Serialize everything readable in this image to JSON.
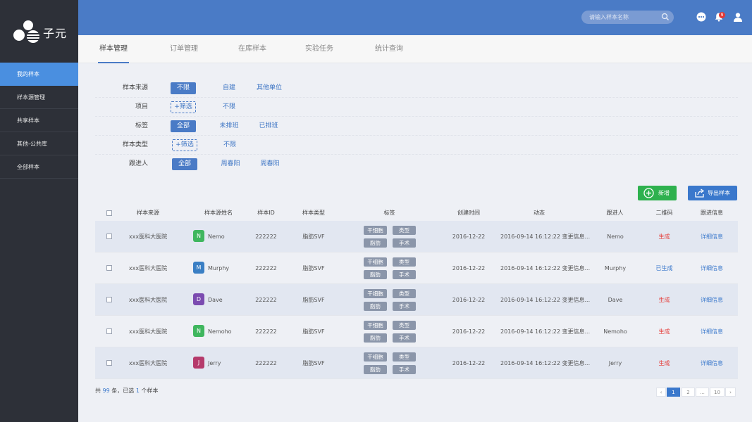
{
  "app": {
    "logo_text": "子元"
  },
  "sidebar": {
    "items": [
      {
        "label": "我的样本"
      },
      {
        "label": "样本源管理"
      },
      {
        "label": "共享样本"
      },
      {
        "label": "其他-公共库"
      },
      {
        "label": "全部样本"
      }
    ]
  },
  "topbar": {
    "search_placeholder": "请输入样本名称",
    "notification_count": "9"
  },
  "tabs": [
    {
      "label": "样本管理"
    },
    {
      "label": "订单管理"
    },
    {
      "label": "在库样本"
    },
    {
      "label": "实验任务"
    },
    {
      "label": "统计查询"
    }
  ],
  "filters": [
    {
      "label": "样本来源",
      "options": [
        "不限",
        "自建",
        "其他单位"
      ]
    },
    {
      "label": "项目",
      "options": [
        "+筛选",
        "不限"
      ]
    },
    {
      "label": "标签",
      "options": [
        "全部",
        "未排班",
        "已排班"
      ]
    },
    {
      "label": "样本类型",
      "options": [
        "+筛选",
        "不限"
      ]
    },
    {
      "label": "跟进人",
      "options": [
        "全部",
        "周春阳",
        "周春阳"
      ]
    }
  ],
  "actions": {
    "add_label": "新增",
    "export_label": "导出样本"
  },
  "table": {
    "headers": [
      "样本来源",
      "样本源姓名",
      "样本ID",
      "样本类型",
      "标签",
      "创建时间",
      "动态",
      "跟进人",
      "二维码",
      "跟进信息"
    ],
    "rows": [
      {
        "source": "xxx医科大医院",
        "avatar": "N",
        "avatar_color": "#3fb65e",
        "name": "Nemo",
        "id": "222222",
        "type": "脂肪SVF",
        "tags": [
          "干细胞",
          "类型",
          "脂肪",
          "手术"
        ],
        "created": "2016-12-22",
        "activity": "2016-09-14 16:12:22 变更信息...",
        "follower": "Nemo",
        "qr": "生成",
        "qr_done": false,
        "detail": "详细信息"
      },
      {
        "source": "xxx医科大医院",
        "avatar": "M",
        "avatar_color": "#3a7fc4",
        "name": "Murphy",
        "id": "222222",
        "type": "脂肪SVF",
        "tags": [
          "干细胞",
          "类型",
          "脂肪",
          "手术"
        ],
        "created": "2016-12-22",
        "activity": "2016-09-14 16:12:22 变更信息...",
        "follower": "Murphy",
        "qr": "已生成",
        "qr_done": true,
        "detail": "详细信息"
      },
      {
        "source": "xxx医科大医院",
        "avatar": "D",
        "avatar_color": "#7b4bb0",
        "name": "Dave",
        "id": "222222",
        "type": "脂肪SVF",
        "tags": [
          "干细胞",
          "类型",
          "脂肪",
          "手术"
        ],
        "created": "2016-12-22",
        "activity": "2016-09-14 16:12:22 变更信息...",
        "follower": "Dave",
        "qr": "生成",
        "qr_done": false,
        "detail": "详细信息"
      },
      {
        "source": "xxx医科大医院",
        "avatar": "N",
        "avatar_color": "#3fb65e",
        "name": "Nemoho",
        "id": "222222",
        "type": "脂肪SVF",
        "tags": [
          "干细胞",
          "类型",
          "脂肪",
          "手术"
        ],
        "created": "2016-12-22",
        "activity": "2016-09-14 16:12:22 变更信息...",
        "follower": "Nemoho",
        "qr": "生成",
        "qr_done": false,
        "detail": "详细信息"
      },
      {
        "source": "xxx医科大医院",
        "avatar": "J",
        "avatar_color": "#b53a6b",
        "name": "Jerry",
        "id": "222222",
        "type": "脂肪SVF",
        "tags": [
          "干细胞",
          "类型",
          "脂肪",
          "手术"
        ],
        "created": "2016-12-22",
        "activity": "2016-09-14 16:12:22 变更信息...",
        "follower": "Jerry",
        "qr": "生成",
        "qr_done": false,
        "detail": "详细信息"
      }
    ]
  },
  "footer": {
    "summary_prefix": "共",
    "total": "99",
    "summary_mid": "条，已选",
    "selected": "1",
    "summary_suffix": "个样本"
  },
  "pagination": {
    "prev": "‹",
    "pages": [
      "1",
      "2",
      "...",
      "10"
    ],
    "next": "›"
  }
}
